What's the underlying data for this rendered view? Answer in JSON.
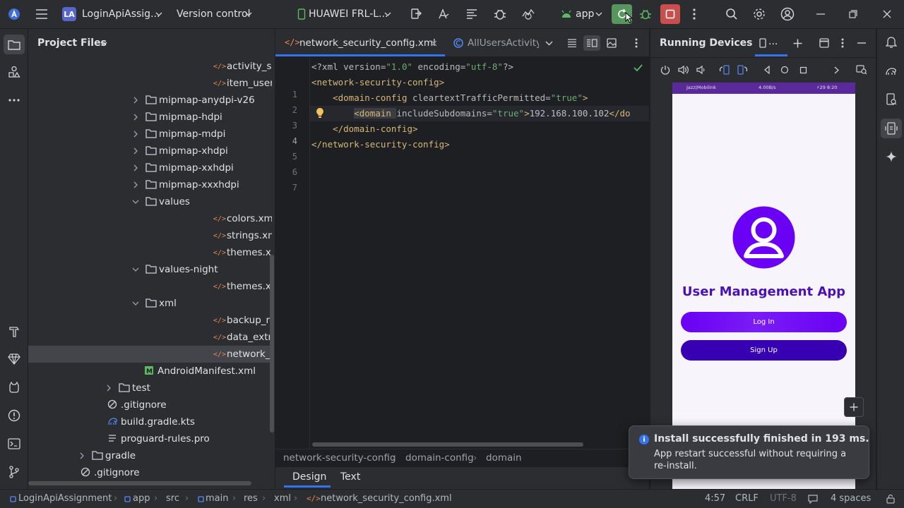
{
  "titlebar": {
    "project_badge": "LA",
    "project_name": "LoginApiAssig...",
    "vcs": "Version control",
    "device": "HUAWEI FRL-L...",
    "run_config": "app"
  },
  "project_panel": {
    "title": "Project Files",
    "items": [
      {
        "label": "activity_signup.xml",
        "kind": "xml",
        "depth": 3,
        "arrow": ""
      },
      {
        "label": "item_user.xml",
        "kind": "xml",
        "depth": 3,
        "arrow": ""
      },
      {
        "label": "mipmap-anydpi-v26",
        "kind": "folder",
        "depth": 2,
        "arrow": "right"
      },
      {
        "label": "mipmap-hdpi",
        "kind": "folder",
        "depth": 2,
        "arrow": "right"
      },
      {
        "label": "mipmap-mdpi",
        "kind": "folder",
        "depth": 2,
        "arrow": "right"
      },
      {
        "label": "mipmap-xhdpi",
        "kind": "folder",
        "depth": 2,
        "arrow": "right"
      },
      {
        "label": "mipmap-xxhdpi",
        "kind": "folder",
        "depth": 2,
        "arrow": "right"
      },
      {
        "label": "mipmap-xxxhdpi",
        "kind": "folder",
        "depth": 2,
        "arrow": "right"
      },
      {
        "label": "values",
        "kind": "folder",
        "depth": 2,
        "arrow": "down"
      },
      {
        "label": "colors.xml",
        "kind": "xml",
        "depth": 3,
        "arrow": ""
      },
      {
        "label": "strings.xml",
        "kind": "xml",
        "depth": 3,
        "arrow": ""
      },
      {
        "label": "themes.xml",
        "kind": "xml",
        "depth": 3,
        "arrow": ""
      },
      {
        "label": "values-night",
        "kind": "folder",
        "depth": 2,
        "arrow": "down"
      },
      {
        "label": "themes.xml",
        "kind": "xml",
        "depth": 3,
        "arrow": ""
      },
      {
        "label": "xml",
        "kind": "folder",
        "depth": 2,
        "arrow": "down"
      },
      {
        "label": "backup_rules.xml",
        "kind": "xml",
        "depth": 3,
        "arrow": ""
      },
      {
        "label": "data_extraction_rules.xml",
        "kind": "xml",
        "depth": 3,
        "arrow": ""
      },
      {
        "label": "network_security_config.xml",
        "kind": "xml",
        "depth": 3,
        "arrow": "",
        "selected": true
      },
      {
        "label": "AndroidManifest.xml",
        "kind": "manifest",
        "depth": 1.5,
        "arrow": ""
      },
      {
        "label": "test",
        "kind": "folder",
        "depth": 1,
        "arrow": "right"
      },
      {
        "label": ".gitignore",
        "kind": "ignore",
        "depth": 0.5,
        "arrow": ""
      },
      {
        "label": "build.gradle.kts",
        "kind": "gradle",
        "depth": 0.5,
        "arrow": ""
      },
      {
        "label": "proguard-rules.pro",
        "kind": "text",
        "depth": 0.5,
        "arrow": ""
      },
      {
        "label": "gradle",
        "kind": "folder",
        "depth": 0,
        "arrow": "right"
      },
      {
        "label": ".gitignore",
        "kind": "ignore",
        "depth": -0.5,
        "arrow": ""
      }
    ]
  },
  "editor": {
    "tabs": [
      {
        "label": "network_security_config.xml",
        "active": true
      },
      {
        "label": "AllUsersActivity",
        "active": false
      }
    ],
    "line_numbers": [
      "1",
      "2",
      "3",
      "4",
      "5",
      "6",
      "7"
    ],
    "lines": [
      [
        {
          "t": "pi",
          "v": "<?xml "
        },
        {
          "t": "attr",
          "v": "version"
        },
        {
          "t": "pi",
          "v": "="
        },
        {
          "t": "val",
          "v": "\"1.0\""
        },
        {
          "t": "pi",
          "v": " "
        },
        {
          "t": "attr",
          "v": "encoding"
        },
        {
          "t": "pi",
          "v": "="
        },
        {
          "t": "val",
          "v": "\"utf-8\""
        },
        {
          "t": "pi",
          "v": "?>"
        }
      ],
      [
        {
          "t": "tag",
          "v": "<network-security-config>"
        }
      ],
      [
        {
          "t": "pi",
          "v": "    "
        },
        {
          "t": "tag",
          "v": "<domain-config "
        },
        {
          "t": "attr",
          "v": "cleartextTrafficPermitted"
        },
        {
          "t": "pi",
          "v": "="
        },
        {
          "t": "val",
          "v": "\"true\""
        },
        {
          "t": "tag",
          "v": ">"
        }
      ],
      [
        {
          "t": "pi",
          "v": "        "
        },
        {
          "t": "tag",
          "v": "<domain "
        },
        {
          "t": "attr",
          "v": "includeSubdomains"
        },
        {
          "t": "pi",
          "v": "="
        },
        {
          "t": "val",
          "v": "\"true\""
        },
        {
          "t": "tag",
          "v": ">"
        },
        {
          "t": "pi",
          "v": "192.168.100.102"
        },
        {
          "t": "tag",
          "v": "</do"
        }
      ],
      [
        {
          "t": "pi",
          "v": "    "
        },
        {
          "t": "tag",
          "v": "</domain-config>"
        }
      ],
      [
        {
          "t": "tag",
          "v": "</network-security-config>"
        }
      ],
      []
    ],
    "breadcrumb": [
      "network-security-config",
      "domain-config",
      "domain"
    ],
    "bottom_tabs": [
      "Design",
      "Text"
    ]
  },
  "devices": {
    "title": "Running Devices",
    "tab_label": "...",
    "phone": {
      "status_left": "Jazz|Mobilink",
      "status_speed": "4.00B/s",
      "status_right": "⚡29 8:20",
      "app_title": "User Management App",
      "login_label": "Log In",
      "signup_label": "Sign Up",
      "primary_color": "#6a00f4",
      "secondary_color": "#3700b3"
    }
  },
  "notification": {
    "title": "Install successfully finished in 193 ms.",
    "body": "App restart successful without requiring a re-install."
  },
  "statusbar": {
    "path": [
      "LoginApiAssignment",
      "app",
      "src",
      "main",
      "res",
      "xml",
      "network_security_config.xml"
    ],
    "position": "4:57",
    "line_sep": "CRLF",
    "encoding": "UTF-8",
    "indent": "4 spaces"
  }
}
